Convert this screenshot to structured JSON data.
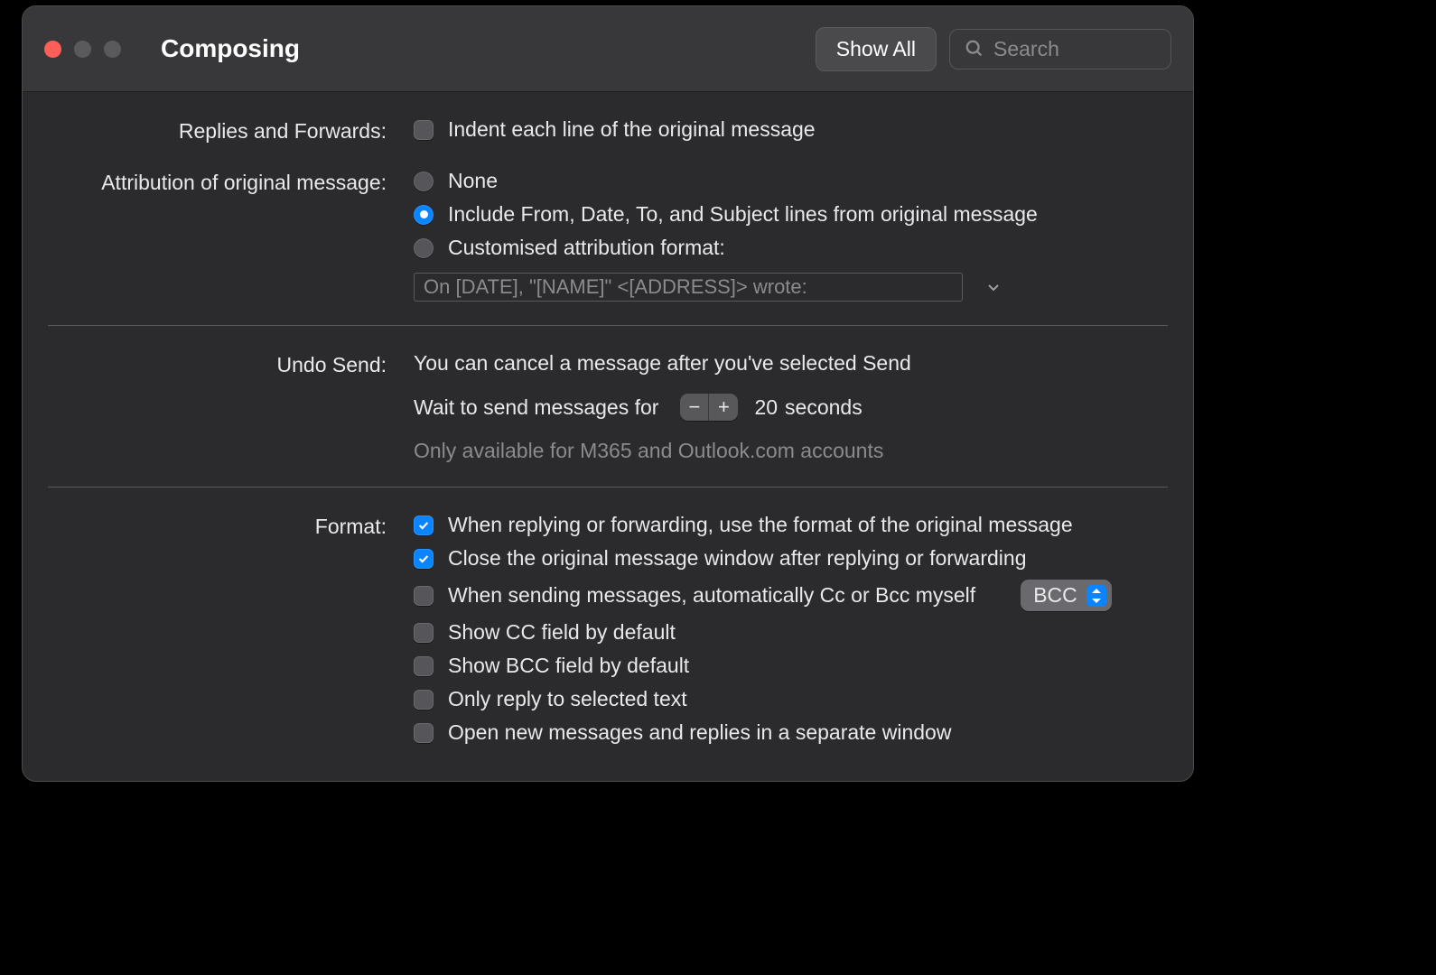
{
  "window": {
    "title": "Composing",
    "show_all": "Show All",
    "search_placeholder": "Search"
  },
  "replies": {
    "label": "Replies and Forwards:",
    "indent": "Indent each line of the original message"
  },
  "attribution": {
    "label": "Attribution of original message:",
    "none": "None",
    "include": "Include From, Date, To, and Subject lines from original message",
    "custom": "Customised attribution format:",
    "custom_template": "On [DATE], \"[NAME]\" <[ADDRESS]> wrote:"
  },
  "undo": {
    "label": "Undo Send:",
    "desc": "You can cancel a message after you've selected Send",
    "wait_prefix": "Wait to send messages for",
    "seconds_value": "20",
    "seconds_suffix": "seconds",
    "note": "Only available for M365 and Outlook.com accounts"
  },
  "format": {
    "label": "Format:",
    "use_original": "When replying or forwarding, use the format of the original message",
    "close_original": "Close the original message window after replying or forwarding",
    "auto_cc": "When sending messages, automatically Cc or Bcc myself",
    "auto_cc_value": "BCC",
    "show_cc": "Show CC field by default",
    "show_bcc": "Show BCC field by default",
    "reply_selected": "Only reply to selected text",
    "open_separate": "Open new messages and replies in a separate window"
  }
}
